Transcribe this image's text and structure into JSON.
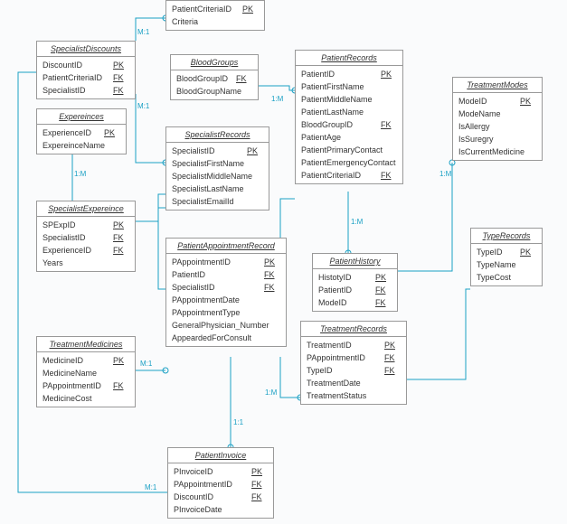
{
  "entities": {
    "patientCriteria": {
      "title": "",
      "attrs": [
        {
          "name": "PatientCriteriaID",
          "key": "PK"
        },
        {
          "name": "Criteria",
          "key": ""
        }
      ]
    },
    "specialistDiscounts": {
      "title": "SpecialistDiscounts",
      "attrs": [
        {
          "name": "DiscountID",
          "key": "PK"
        },
        {
          "name": "PatientCriteriaID",
          "key": "FK"
        },
        {
          "name": "SpecialistID",
          "key": "FK"
        }
      ]
    },
    "experiences": {
      "title": "Expereinces",
      "attrs": [
        {
          "name": "ExperienceID",
          "key": "PK"
        },
        {
          "name": "ExpereinceName",
          "key": ""
        }
      ]
    },
    "bloodGroups": {
      "title": "BloodGroups",
      "attrs": [
        {
          "name": "BloodGroupID",
          "key": "FK"
        },
        {
          "name": "BloodGroupName",
          "key": ""
        }
      ]
    },
    "patientRecords": {
      "title": "PatientRecords",
      "attrs": [
        {
          "name": "PatientID",
          "key": "PK"
        },
        {
          "name": "PatientFirstName",
          "key": ""
        },
        {
          "name": "PatientMiddleName",
          "key": ""
        },
        {
          "name": "PatientLastName",
          "key": ""
        },
        {
          "name": "BloodGroupID",
          "key": "FK"
        },
        {
          "name": "PatientAge",
          "key": ""
        },
        {
          "name": "PatientPrimaryContact",
          "key": ""
        },
        {
          "name": "PatientEmergencyContact",
          "key": ""
        },
        {
          "name": "PatientCriteriaID",
          "key": "FK"
        }
      ]
    },
    "treatmentModes": {
      "title": "TreatmentModes",
      "attrs": [
        {
          "name": "ModeID",
          "key": "PK"
        },
        {
          "name": "ModeName",
          "key": ""
        },
        {
          "name": "IsAllergy",
          "key": ""
        },
        {
          "name": "IsSuregry",
          "key": ""
        },
        {
          "name": "IsCurrentMedicine",
          "key": ""
        }
      ]
    },
    "specialistRecords": {
      "title": "SpecialistRecords",
      "attrs": [
        {
          "name": "SpecialistID",
          "key": "PK"
        },
        {
          "name": "SpecialistFirstName",
          "key": ""
        },
        {
          "name": "SpecialistMiddleName",
          "key": ""
        },
        {
          "name": "SpecialistLastName",
          "key": ""
        },
        {
          "name": "SpecialistEmailId",
          "key": ""
        }
      ]
    },
    "specialistExperience": {
      "title": "SpecialistExpereince",
      "attrs": [
        {
          "name": "SPExpID",
          "key": "PK"
        },
        {
          "name": "SpecialistID",
          "key": "FK"
        },
        {
          "name": "ExperienceID",
          "key": "FK"
        },
        {
          "name": "Years",
          "key": ""
        }
      ]
    },
    "patientAppointmentRecord": {
      "title": "PatientAppointmentRecord",
      "attrs": [
        {
          "name": "PAppointmentID",
          "key": "PK"
        },
        {
          "name": "PatientID",
          "key": "FK"
        },
        {
          "name": "SpecialistID",
          "key": "FK"
        },
        {
          "name": "PAppointmentDate",
          "key": ""
        },
        {
          "name": "PAppointmentType",
          "key": ""
        },
        {
          "name": "GeneralPhysician_Number",
          "key": ""
        },
        {
          "name": "AppeardedForConsult",
          "key": ""
        }
      ]
    },
    "patientHistory": {
      "title": "PatientHistory",
      "attrs": [
        {
          "name": "HistotyID",
          "key": "PK"
        },
        {
          "name": "PatientID",
          "key": "FK"
        },
        {
          "name": "ModeID",
          "key": "FK"
        }
      ]
    },
    "typeRecords": {
      "title": "TypeRecords",
      "attrs": [
        {
          "name": "TypeID",
          "key": "PK"
        },
        {
          "name": "TypeName",
          "key": ""
        },
        {
          "name": "TypeCost",
          "key": ""
        }
      ]
    },
    "treatmentRecords": {
      "title": "TreatmentRecords",
      "attrs": [
        {
          "name": "TreatmentID",
          "key": "PK"
        },
        {
          "name": "PAppointmentID",
          "key": "FK"
        },
        {
          "name": "TypeID",
          "key": "FK"
        },
        {
          "name": "TreatmentDate",
          "key": ""
        },
        {
          "name": "TreatmentStatus",
          "key": ""
        }
      ]
    },
    "treatmentMedicines": {
      "title": "TreatmentMedicines",
      "attrs": [
        {
          "name": "MedicineID",
          "key": "PK"
        },
        {
          "name": "MedicineName",
          "key": ""
        },
        {
          "name": "PAppointmentID",
          "key": "FK"
        },
        {
          "name": "MedicineCost",
          "key": ""
        }
      ]
    },
    "patientInvoice": {
      "title": "PatientInvoice",
      "attrs": [
        {
          "name": "PInvoiceID",
          "key": "PK"
        },
        {
          "name": "PAppointmentID",
          "key": "FK"
        },
        {
          "name": "DiscountID",
          "key": "FK"
        },
        {
          "name": "PInvoiceDate",
          "key": ""
        }
      ]
    }
  },
  "cardinalities": {
    "m1a": "M:1",
    "m1b": "M:1",
    "oneM1": "1:M",
    "oneM2": "1:M",
    "oneM3": "1:M",
    "oneM4": "1:M",
    "oneM5": "1:M",
    "m1c": "M:1",
    "m1d": "M:1",
    "oneOne": "1:1"
  }
}
